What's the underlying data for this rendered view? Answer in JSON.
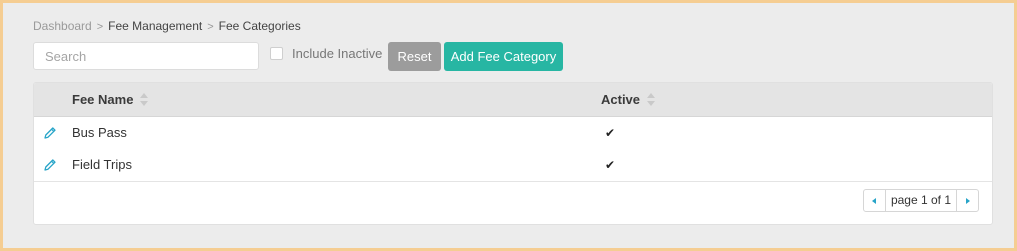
{
  "breadcrumb": {
    "items": [
      "Dashboard",
      "Fee Management",
      "Fee Categories"
    ],
    "separator": ">"
  },
  "toolbar": {
    "search_placeholder": "Search",
    "search_value": "",
    "include_inactive_label": "Include Inactive",
    "include_inactive_checked": false,
    "reset_label": "Reset",
    "add_label": "Add Fee Category"
  },
  "table": {
    "columns": [
      "Fee Name",
      "Active"
    ],
    "rows": [
      {
        "name": "Bus Pass",
        "active": "✔",
        "edit_icon": "pencil-icon"
      },
      {
        "name": "Field Trips",
        "active": "✔",
        "edit_icon": "pencil-icon"
      }
    ]
  },
  "pagination": {
    "text": "page 1 of 1"
  },
  "colors": {
    "accent": "#27b6a3",
    "reset_button": "#9c9c9c",
    "frame_border": "#f5cd92",
    "icon_blue": "#27a4c8"
  }
}
